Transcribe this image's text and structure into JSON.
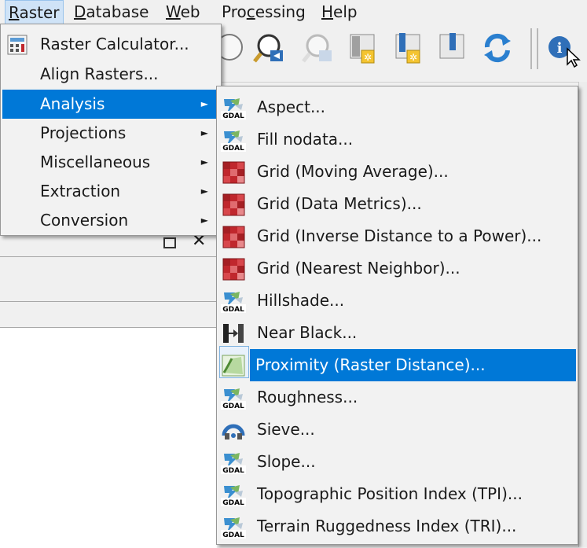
{
  "menubar": {
    "items": [
      {
        "prefix": "",
        "mnemonic": "R",
        "rest": "aster"
      },
      {
        "prefix": "",
        "mnemonic": "D",
        "rest": "atabase"
      },
      {
        "prefix": "",
        "mnemonic": "W",
        "rest": "eb"
      },
      {
        "prefix": "Pro",
        "mnemonic": "c",
        "rest": "essing"
      },
      {
        "prefix": "",
        "mnemonic": "H",
        "rest": "elp"
      }
    ]
  },
  "raster_menu": {
    "items": [
      {
        "label": "Raster Calculator..."
      },
      {
        "label": "Align Rasters..."
      },
      {
        "label": "Analysis"
      },
      {
        "label": "Projections"
      },
      {
        "label": "Miscellaneous"
      },
      {
        "label": "Extraction"
      },
      {
        "label": "Conversion"
      }
    ],
    "submenu_arrow": "►"
  },
  "analysis_menu": {
    "items": [
      {
        "label": "Aspect...",
        "icon": "gdal-icon"
      },
      {
        "label": "Fill nodata...",
        "icon": "gdal-icon"
      },
      {
        "label": "Grid (Moving Average)...",
        "icon": "grid-icon"
      },
      {
        "label": "Grid (Data Metrics)...",
        "icon": "grid-icon"
      },
      {
        "label": "Grid (Inverse Distance to a Power)...",
        "icon": "grid-icon"
      },
      {
        "label": "Grid (Nearest Neighbor)...",
        "icon": "grid-icon"
      },
      {
        "label": "Hillshade...",
        "icon": "gdal-icon"
      },
      {
        "label": "Near Black...",
        "icon": "near-black-icon"
      },
      {
        "label": "Proximity (Raster Distance)...",
        "icon": "proximity-icon"
      },
      {
        "label": "Roughness...",
        "icon": "gdal-icon"
      },
      {
        "label": "Sieve...",
        "icon": "sieve-icon"
      },
      {
        "label": "Slope...",
        "icon": "gdal-icon"
      },
      {
        "label": "Topographic Position Index (TPI)...",
        "icon": "gdal-icon"
      },
      {
        "label": "Terrain Ruggedness Index (TRI)...",
        "icon": "gdal-icon"
      }
    ]
  },
  "icons": {
    "gdal_text": "GDAL"
  },
  "colors": {
    "selection": "#0078d7",
    "selection_text": "#ffffff",
    "grid_red": "#c0272d"
  }
}
